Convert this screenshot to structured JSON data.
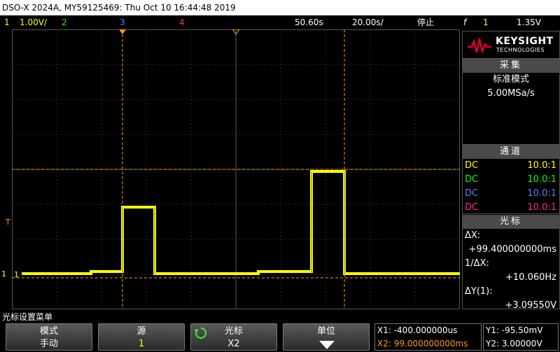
{
  "title": "DSO-X 2024A, MY59125469: Thu Oct 10 16:44:48 2019",
  "status": {
    "ch1_num": "1",
    "ch1_scale": "1.00V/",
    "ch2_num": "2",
    "ch3_num": "3",
    "ch4_num": "4",
    "delay": "50.60s",
    "timebase": "20.00s/",
    "run_state": "停止",
    "trigger_symbol": "f",
    "trigger_src": "1",
    "trigger_level": "1.35V"
  },
  "colors": {
    "ch1": "#ffff00",
    "ch2": "#00ff00",
    "ch3": "#5b7bff",
    "ch4": "#ff2a8a",
    "cursor": "#ff9a1a"
  },
  "logo": {
    "brand": "KEYSIGHT",
    "sub": "TECHNOLOGIES"
  },
  "acquire": {
    "header": "采集",
    "mode": "标准模式",
    "rate": "5.00MSa/s"
  },
  "channels": {
    "header": "通道",
    "rows": [
      {
        "coupling": "DC",
        "probe": "10.0:1"
      },
      {
        "coupling": "DC",
        "probe": "10.0:1"
      },
      {
        "coupling": "DC",
        "probe": "10.0:1"
      },
      {
        "coupling": "DC",
        "probe": "10.0:1"
      }
    ]
  },
  "cursors": {
    "header": "光标",
    "dx_label": "ΔX:",
    "dx_value": "+99.400000000ms",
    "inv_dx_label": "1/ΔX:",
    "inv_dx_value": "+10.060Hz",
    "dy_label": "ΔY(1):",
    "dy_value": "+3.09550V"
  },
  "markers": {
    "trigger_level": "T",
    "ch1_ground": "1",
    "ch1_label": "1"
  },
  "softkeys": {
    "menu_title": "光标设置菜单",
    "mode": {
      "label": "模式",
      "value": "手动"
    },
    "source": {
      "label": "源",
      "value": "1"
    },
    "cursor": {
      "label": "光标",
      "value": "X2"
    },
    "units": {
      "label": "单位"
    }
  },
  "readout": {
    "x1": "X1: -400.000000us",
    "x2": "X2: 99.000000000ms",
    "y1": "Y1: -95.50mV",
    "y2": "Y2: 3.00000V"
  }
}
